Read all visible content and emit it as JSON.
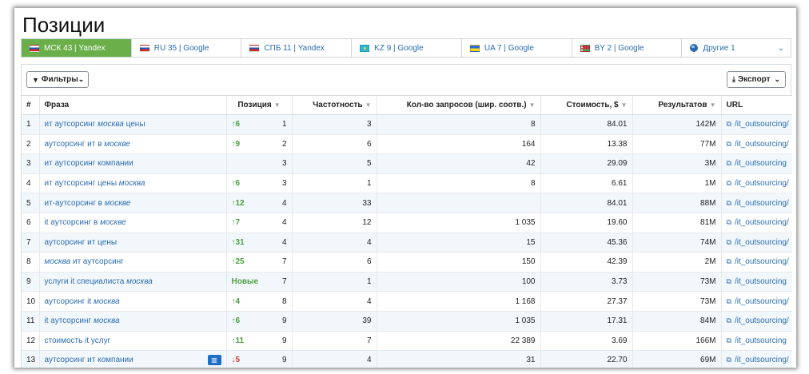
{
  "page": {
    "title": "Позиции"
  },
  "tabs": [
    {
      "label": "МСК 43 | Yandex",
      "flag": "ru",
      "active": true
    },
    {
      "label": "RU 35 | Google",
      "flag": "ru",
      "active": false
    },
    {
      "label": "СПБ 11 | Yandex",
      "flag": "ru",
      "active": false
    },
    {
      "label": "KZ 9 | Google",
      "flag": "kz",
      "active": false
    },
    {
      "label": "UA 7 | Google",
      "flag": "ua",
      "active": false
    },
    {
      "label": "BY 2 | Google",
      "flag": "by",
      "active": false
    },
    {
      "label": "Другие 1",
      "flag": "globe",
      "active": false
    }
  ],
  "toolbar": {
    "filters_label": "Фильтры",
    "export_label": "Экспорт"
  },
  "table": {
    "headers": {
      "num": "#",
      "phrase": "Фраза",
      "position": "Позиция",
      "frequency": "Частотность",
      "queries": "Кол-во запросов (шир. соотв.)",
      "cost": "Стоимость, $",
      "results": "Результатов",
      "url": "URL"
    },
    "rows": [
      {
        "num": "1",
        "phrase_pre": "ит аутсорсинг ",
        "phrase_em": "москва",
        "phrase_post": " цены",
        "change": "↑6",
        "change_type": "up",
        "position": "1",
        "frequency": "3",
        "queries": "8",
        "cost": "84.01",
        "results": "142M",
        "url": "/it_outsourcing/",
        "map_badge": false
      },
      {
        "num": "2",
        "phrase_pre": "аутсорсинг ит в ",
        "phrase_em": "москве",
        "phrase_post": "",
        "change": "↑9",
        "change_type": "up",
        "position": "2",
        "frequency": "6",
        "queries": "164",
        "cost": "13.38",
        "results": "77M",
        "url": "/it_outsourcing/",
        "map_badge": false
      },
      {
        "num": "3",
        "phrase_pre": "ит аутсорсинг компании",
        "phrase_em": "",
        "phrase_post": "",
        "change": "",
        "change_type": "none",
        "position": "3",
        "frequency": "5",
        "queries": "42",
        "cost": "29.09",
        "results": "3M",
        "url": "/it_outsourcing",
        "map_badge": false
      },
      {
        "num": "4",
        "phrase_pre": "ит аутсорсинг цены ",
        "phrase_em": "москва",
        "phrase_post": "",
        "change": "↑6",
        "change_type": "up",
        "position": "3",
        "frequency": "1",
        "queries": "8",
        "cost": "6.61",
        "results": "1M",
        "url": "/it_outsourcing/",
        "map_badge": false
      },
      {
        "num": "5",
        "phrase_pre": "ит-аутсорсинг в ",
        "phrase_em": "москве",
        "phrase_post": "",
        "change": "↑12",
        "change_type": "up",
        "position": "4",
        "frequency": "33",
        "queries": "",
        "cost": "84.01",
        "results": "88M",
        "url": "/it_outsourcing/",
        "map_badge": false
      },
      {
        "num": "6",
        "phrase_pre": "it аутсорсинг в ",
        "phrase_em": "москве",
        "phrase_post": "",
        "change": "↑7",
        "change_type": "up",
        "position": "4",
        "frequency": "12",
        "queries": "1 035",
        "cost": "19.60",
        "results": "81M",
        "url": "/it_outsourcing/",
        "map_badge": false
      },
      {
        "num": "7",
        "phrase_pre": "аутсорсинг ит цены",
        "phrase_em": "",
        "phrase_post": "",
        "change": "↑31",
        "change_type": "up",
        "position": "4",
        "frequency": "4",
        "queries": "15",
        "cost": "45.36",
        "results": "74M",
        "url": "/it_outsourcing/",
        "map_badge": false
      },
      {
        "num": "8",
        "phrase_pre": "",
        "phrase_em": "москва",
        "phrase_post": " ит аутсорсинг",
        "change": "↑25",
        "change_type": "up",
        "position": "7",
        "frequency": "6",
        "queries": "150",
        "cost": "42.39",
        "results": "2M",
        "url": "/it_outsourcing/",
        "map_badge": false
      },
      {
        "num": "9",
        "phrase_pre": "услуги it специалиста ",
        "phrase_em": "москва",
        "phrase_post": "",
        "change": "Новые",
        "change_type": "new",
        "position": "7",
        "frequency": "1",
        "queries": "100",
        "cost": "3.73",
        "results": "73M",
        "url": "/it_outsourcing",
        "map_badge": false
      },
      {
        "num": "10",
        "phrase_pre": "аутсорсинг it ",
        "phrase_em": "москва",
        "phrase_post": "",
        "change": "↑4",
        "change_type": "up",
        "position": "8",
        "frequency": "4",
        "queries": "1 168",
        "cost": "27.37",
        "results": "73M",
        "url": "/it_outsourcing/",
        "map_badge": false
      },
      {
        "num": "11",
        "phrase_pre": "it аутсорсинг ",
        "phrase_em": "москва",
        "phrase_post": "",
        "change": "↑6",
        "change_type": "up",
        "position": "9",
        "frequency": "39",
        "queries": "1 035",
        "cost": "17.31",
        "results": "84M",
        "url": "/it_outsourcing/",
        "map_badge": false
      },
      {
        "num": "12",
        "phrase_pre": "стоимость it услуг",
        "phrase_em": "",
        "phrase_post": "",
        "change": "↑11",
        "change_type": "up",
        "position": "9",
        "frequency": "7",
        "queries": "22 389",
        "cost": "3.69",
        "results": "166M",
        "url": "/it_outsourcing",
        "map_badge": false
      },
      {
        "num": "13",
        "phrase_pre": "аутсорсинг ит компании",
        "phrase_em": "",
        "phrase_post": "",
        "change": "↓5",
        "change_type": "down",
        "position": "9",
        "frequency": "4",
        "queries": "31",
        "cost": "22.70",
        "results": "69M",
        "url": "/it_outsourcing/",
        "map_badge": true
      }
    ]
  },
  "icons": {
    "filter": "filter-icon",
    "export": "download-icon",
    "external": "external-link-icon",
    "map": "map-icon",
    "sort": "sort-arrow-icon"
  },
  "colors": {
    "active_tab": "#6aaf4a",
    "link": "#2b6cb0",
    "up": "#4aa13c",
    "down": "#d9382a",
    "row_alt": "#f2f7fc",
    "map_badge": "#1f6fc5"
  }
}
